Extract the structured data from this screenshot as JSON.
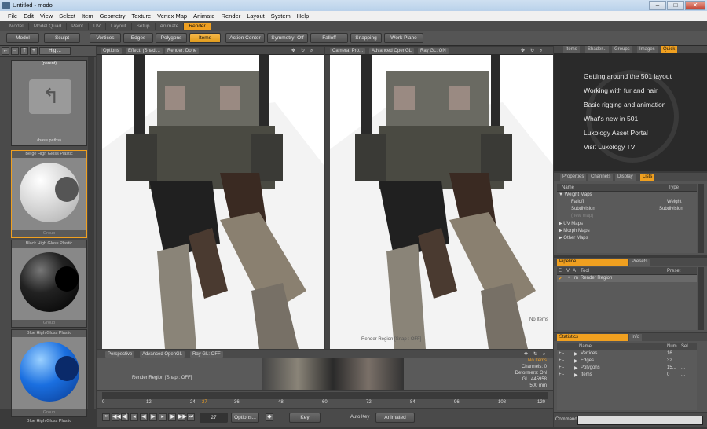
{
  "window": {
    "title": "Untitled - modo"
  },
  "menu": [
    "File",
    "Edit",
    "View",
    "Select",
    "Item",
    "Geometry",
    "Texture",
    "Vertex Map",
    "Animate",
    "Render",
    "Layout",
    "System",
    "Help"
  ],
  "layout_tabs": [
    "Model",
    "Model Quad",
    "Paint",
    "UV",
    "Layout",
    "Setup",
    "Animate",
    "Render"
  ],
  "layout_active": "Render",
  "toolbar": {
    "model": "Model",
    "sculpt": "Sculpt",
    "vertices": "Vertices",
    "edges": "Edges",
    "polygons": "Polygons",
    "items": "Items",
    "action_center": "Action Center",
    "symmetry": "Symmetry: Off",
    "falloff": "Falloff",
    "snapping": "Snapping",
    "work_plane": "Work Plane"
  },
  "presets": {
    "dropdown": "Hig ...",
    "folder_top": "(parent)",
    "folder_bottom": "(base paths)",
    "items": [
      {
        "name": "Beige High Gloss Plastic",
        "type": "Group",
        "color": "#e6e6e6"
      },
      {
        "name": "Black High Gloss Plastic",
        "type": "Group",
        "color": "#1a1a1a"
      },
      {
        "name": "Blue High Gloss Plastic",
        "type": "Group",
        "color": "#1a6fe0"
      }
    ],
    "bottom_label": "Blue High Gloss Plastic"
  },
  "viewport_left": {
    "options": "Options",
    "effect": "Effect: (Shadi...",
    "render": "Render: Done"
  },
  "viewport_right": {
    "camera": "Camera_Pro...",
    "gl": "Advanced OpenGL",
    "ray": "Ray GL: ON",
    "region": "Render Region [Snap : OFF]",
    "no_items": "No Items"
  },
  "viewport_bottom": {
    "perspective": "Perspective",
    "gl": "Advanced OpenGL",
    "ray": "Ray GL: OFF",
    "region": "Render Region [Snap : OFF]",
    "no_items": "No Items",
    "channels": "Channels: 0",
    "deformers": "Deformers: ON",
    "gl_count": "GL: 445958",
    "size": "500 mm"
  },
  "timeline": {
    "ticks": [
      "0",
      "12",
      "24",
      "36",
      "48",
      "60",
      "72",
      "84",
      "96",
      "108",
      "120"
    ],
    "extra_ticks": [
      "27",
      "60"
    ],
    "frame": "27",
    "options": "Options...",
    "key": "Key",
    "auto_key": "Auto Key",
    "animated": "Animated"
  },
  "right_tabs_top": [
    "Items",
    "Shader...",
    "Groups",
    "Images",
    "Quick"
  ],
  "quick_links": [
    "Getting around the 501 layout",
    "Working with fur and hair",
    "Basic rigging and animation",
    "What's new in 501",
    "Luxology Asset Portal",
    "Visit Luxology TV"
  ],
  "right_tabs_mid": [
    "Properties",
    "Channels",
    "Display",
    "Lists"
  ],
  "lists": {
    "col_name": "Name",
    "col_type": "Type",
    "rows": [
      {
        "name": "Weight Maps",
        "type": "",
        "indent": 0,
        "arrow": "▼"
      },
      {
        "name": "Falloff",
        "type": "Weight",
        "indent": 1,
        "arrow": ""
      },
      {
        "name": "Subdivision",
        "type": "Subdivision",
        "indent": 1,
        "arrow": ""
      },
      {
        "name": "(new map)",
        "type": "",
        "indent": 1,
        "arrow": ""
      },
      {
        "name": "UV Maps",
        "type": "",
        "indent": 0,
        "arrow": "▶"
      },
      {
        "name": "Morph Maps",
        "type": "",
        "indent": 0,
        "arrow": "▶"
      },
      {
        "name": "Other Maps",
        "type": "",
        "indent": 0,
        "arrow": "▶"
      }
    ]
  },
  "pipeline": {
    "tab1": "Pipeline",
    "tab2": "Presets",
    "cols": [
      "E",
      "V",
      "A",
      "Tool",
      "Preset"
    ],
    "row": "Render Region"
  },
  "stats": {
    "tab1": "Statistics",
    "tab2": "Info",
    "cols": [
      "Name",
      "Num",
      "Sel"
    ],
    "rows": [
      {
        "name": "Vertices",
        "num": "16...",
        "sel": "..."
      },
      {
        "name": "Edges",
        "num": "32...",
        "sel": "..."
      },
      {
        "name": "Polygons",
        "num": "15...",
        "sel": "..."
      },
      {
        "name": "Items",
        "num": "0",
        "sel": "..."
      }
    ]
  },
  "command": {
    "label": "Command"
  }
}
